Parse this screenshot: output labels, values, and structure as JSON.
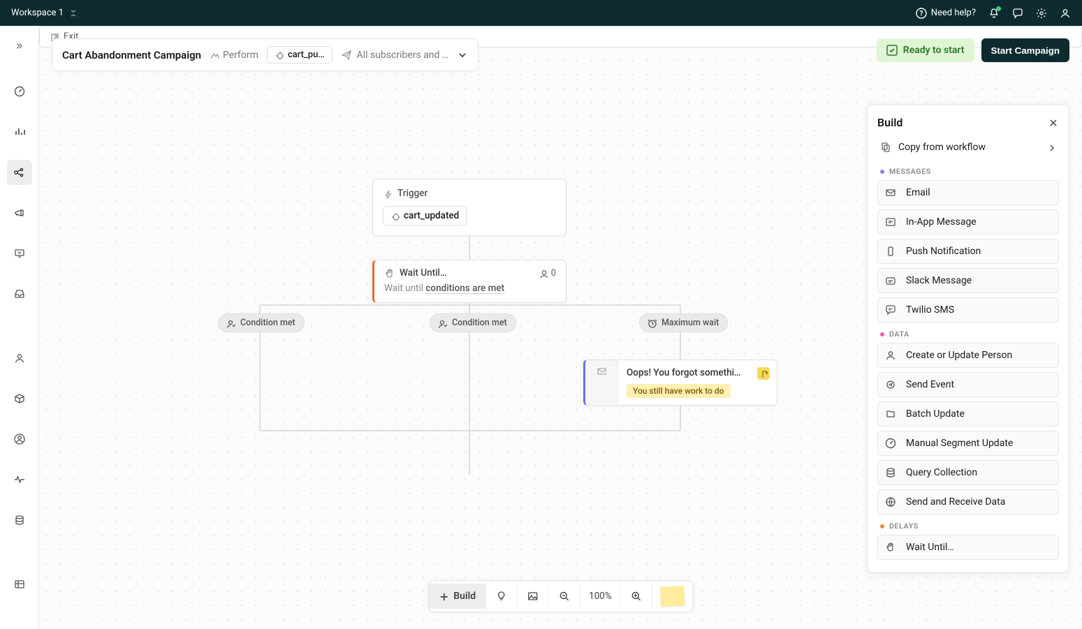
{
  "topbar": {
    "workspace": "Workspace 1",
    "help": "Need help?"
  },
  "header": {
    "title": "Cart Abandonment Campaign",
    "perform": "Perform",
    "trigger_chip": "cart_pu…",
    "audience": "All subscribers and …"
  },
  "actions": {
    "ready": "Ready to start",
    "start": "Start Campaign"
  },
  "workflow": {
    "trigger": {
      "label": "Trigger",
      "event": "cart_updated"
    },
    "wait": {
      "label": "Wait Until…",
      "count": "0",
      "desc_prefix": "Wait until ",
      "desc_link": "conditions are met"
    },
    "branches": {
      "b1": "Condition met",
      "b2": "Condition met",
      "b3": "Maximum wait"
    },
    "message": {
      "title": "Oops! You forgot somethin…",
      "tag": "You still have work to do"
    },
    "exit": "Exit"
  },
  "build": {
    "title": "Build",
    "copy": "Copy from workflow",
    "sections": {
      "messages": "MESSAGES",
      "data": "DATA",
      "delays": "DELAYS"
    },
    "messages": [
      {
        "label": "Email"
      },
      {
        "label": "In-App Message"
      },
      {
        "label": "Push Notification"
      },
      {
        "label": "Slack Message"
      },
      {
        "label": "Twilio SMS"
      }
    ],
    "data": [
      {
        "label": "Create or Update Person"
      },
      {
        "label": "Send Event"
      },
      {
        "label": "Batch Update"
      },
      {
        "label": "Manual Segment Update"
      },
      {
        "label": "Query Collection"
      },
      {
        "label": "Send and Receive Data"
      }
    ],
    "delays": [
      {
        "label": "Wait Until…"
      }
    ]
  },
  "bottombar": {
    "build": "Build",
    "zoom": "100%"
  }
}
